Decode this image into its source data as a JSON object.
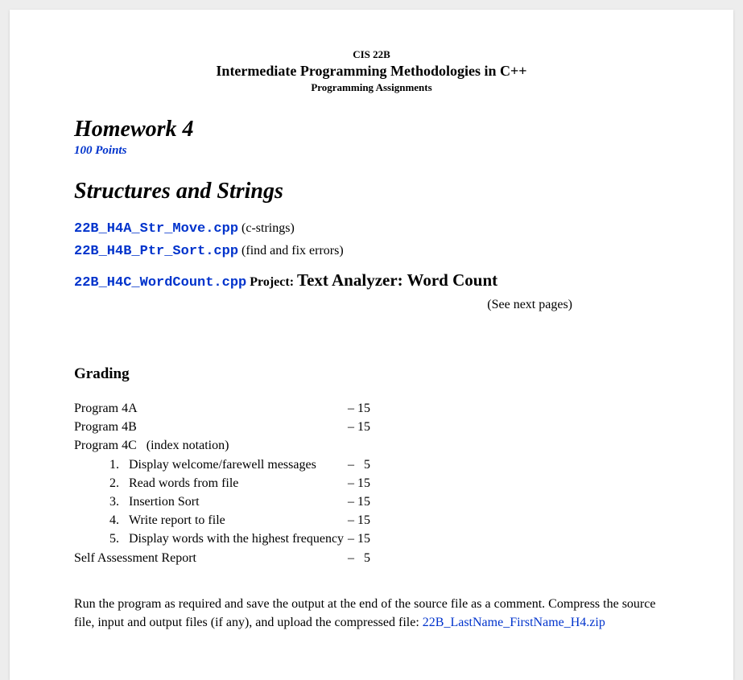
{
  "header": {
    "course": "CIS 22B",
    "title": "Intermediate Programming Methodologies in C++",
    "subtitle": "Programming Assignments"
  },
  "hw": {
    "title": "Homework 4",
    "points": "100 Points"
  },
  "topic": "Structures and Strings",
  "files": [
    {
      "code": "22B_H4A_Str_Move.cpp",
      "note": "  (c-strings)"
    },
    {
      "code": "22B_H4B_Ptr_Sort.cpp",
      "note": "  (find and fix errors)"
    }
  ],
  "project": {
    "code": "22B_H4C_WordCount.cpp",
    "label": " Project: ",
    "name": "Text Analyzer: Word Count",
    "see": "(See next pages)"
  },
  "grading": {
    "heading": "Grading",
    "rows": [
      {
        "label": "Program 4A",
        "score": "– 15"
      },
      {
        "label": "Program 4B",
        "score": "– 15"
      }
    ],
    "program4c": {
      "label": "Program 4C",
      "note": "(index notation)"
    },
    "subitems": [
      {
        "n": "1.",
        "text": "Display welcome/farewell messages",
        "score": "–   5"
      },
      {
        "n": "2.",
        "text": "Read words from file",
        "score": "– 15"
      },
      {
        "n": "3.",
        "text": "Insertion Sort",
        "score": "– 15"
      },
      {
        "n": "4.",
        "text": "Write report to file",
        "score": "– 15"
      },
      {
        "n": "5.",
        "text": "Display words with the highest frequency",
        "score": "– 15"
      }
    ],
    "self": {
      "label": "Self Assessment Report",
      "score": "–   5"
    }
  },
  "instructions": {
    "text": "Run the program as required and save the output at the end of the source file as a comment. Compress the source file, input and output files (if any), and upload the compressed file: ",
    "zip": "22B_LastName_FirstName_H4.zip"
  }
}
